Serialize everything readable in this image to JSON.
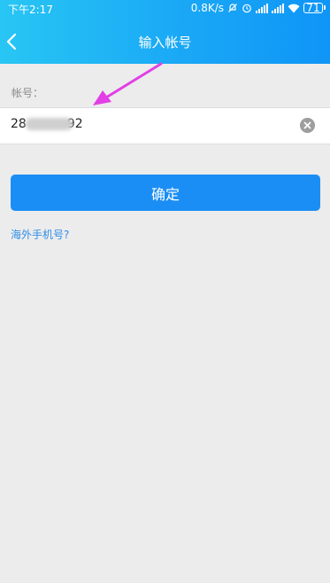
{
  "status_bar": {
    "time": "下午2:17",
    "speed": "0.8K/s",
    "battery": "71"
  },
  "header": {
    "title": "输入帐号"
  },
  "form": {
    "account_label": "帐号：",
    "account_prefix": "28",
    "account_suffix": "92"
  },
  "actions": {
    "confirm_label": "确定",
    "overseas_link": "海外手机号?"
  },
  "colors": {
    "header_start": "#28c6f4",
    "header_end": "#0f95f7",
    "button": "#1b8ef5",
    "link": "#2f8ee8",
    "arrow": "#e23fe6"
  }
}
